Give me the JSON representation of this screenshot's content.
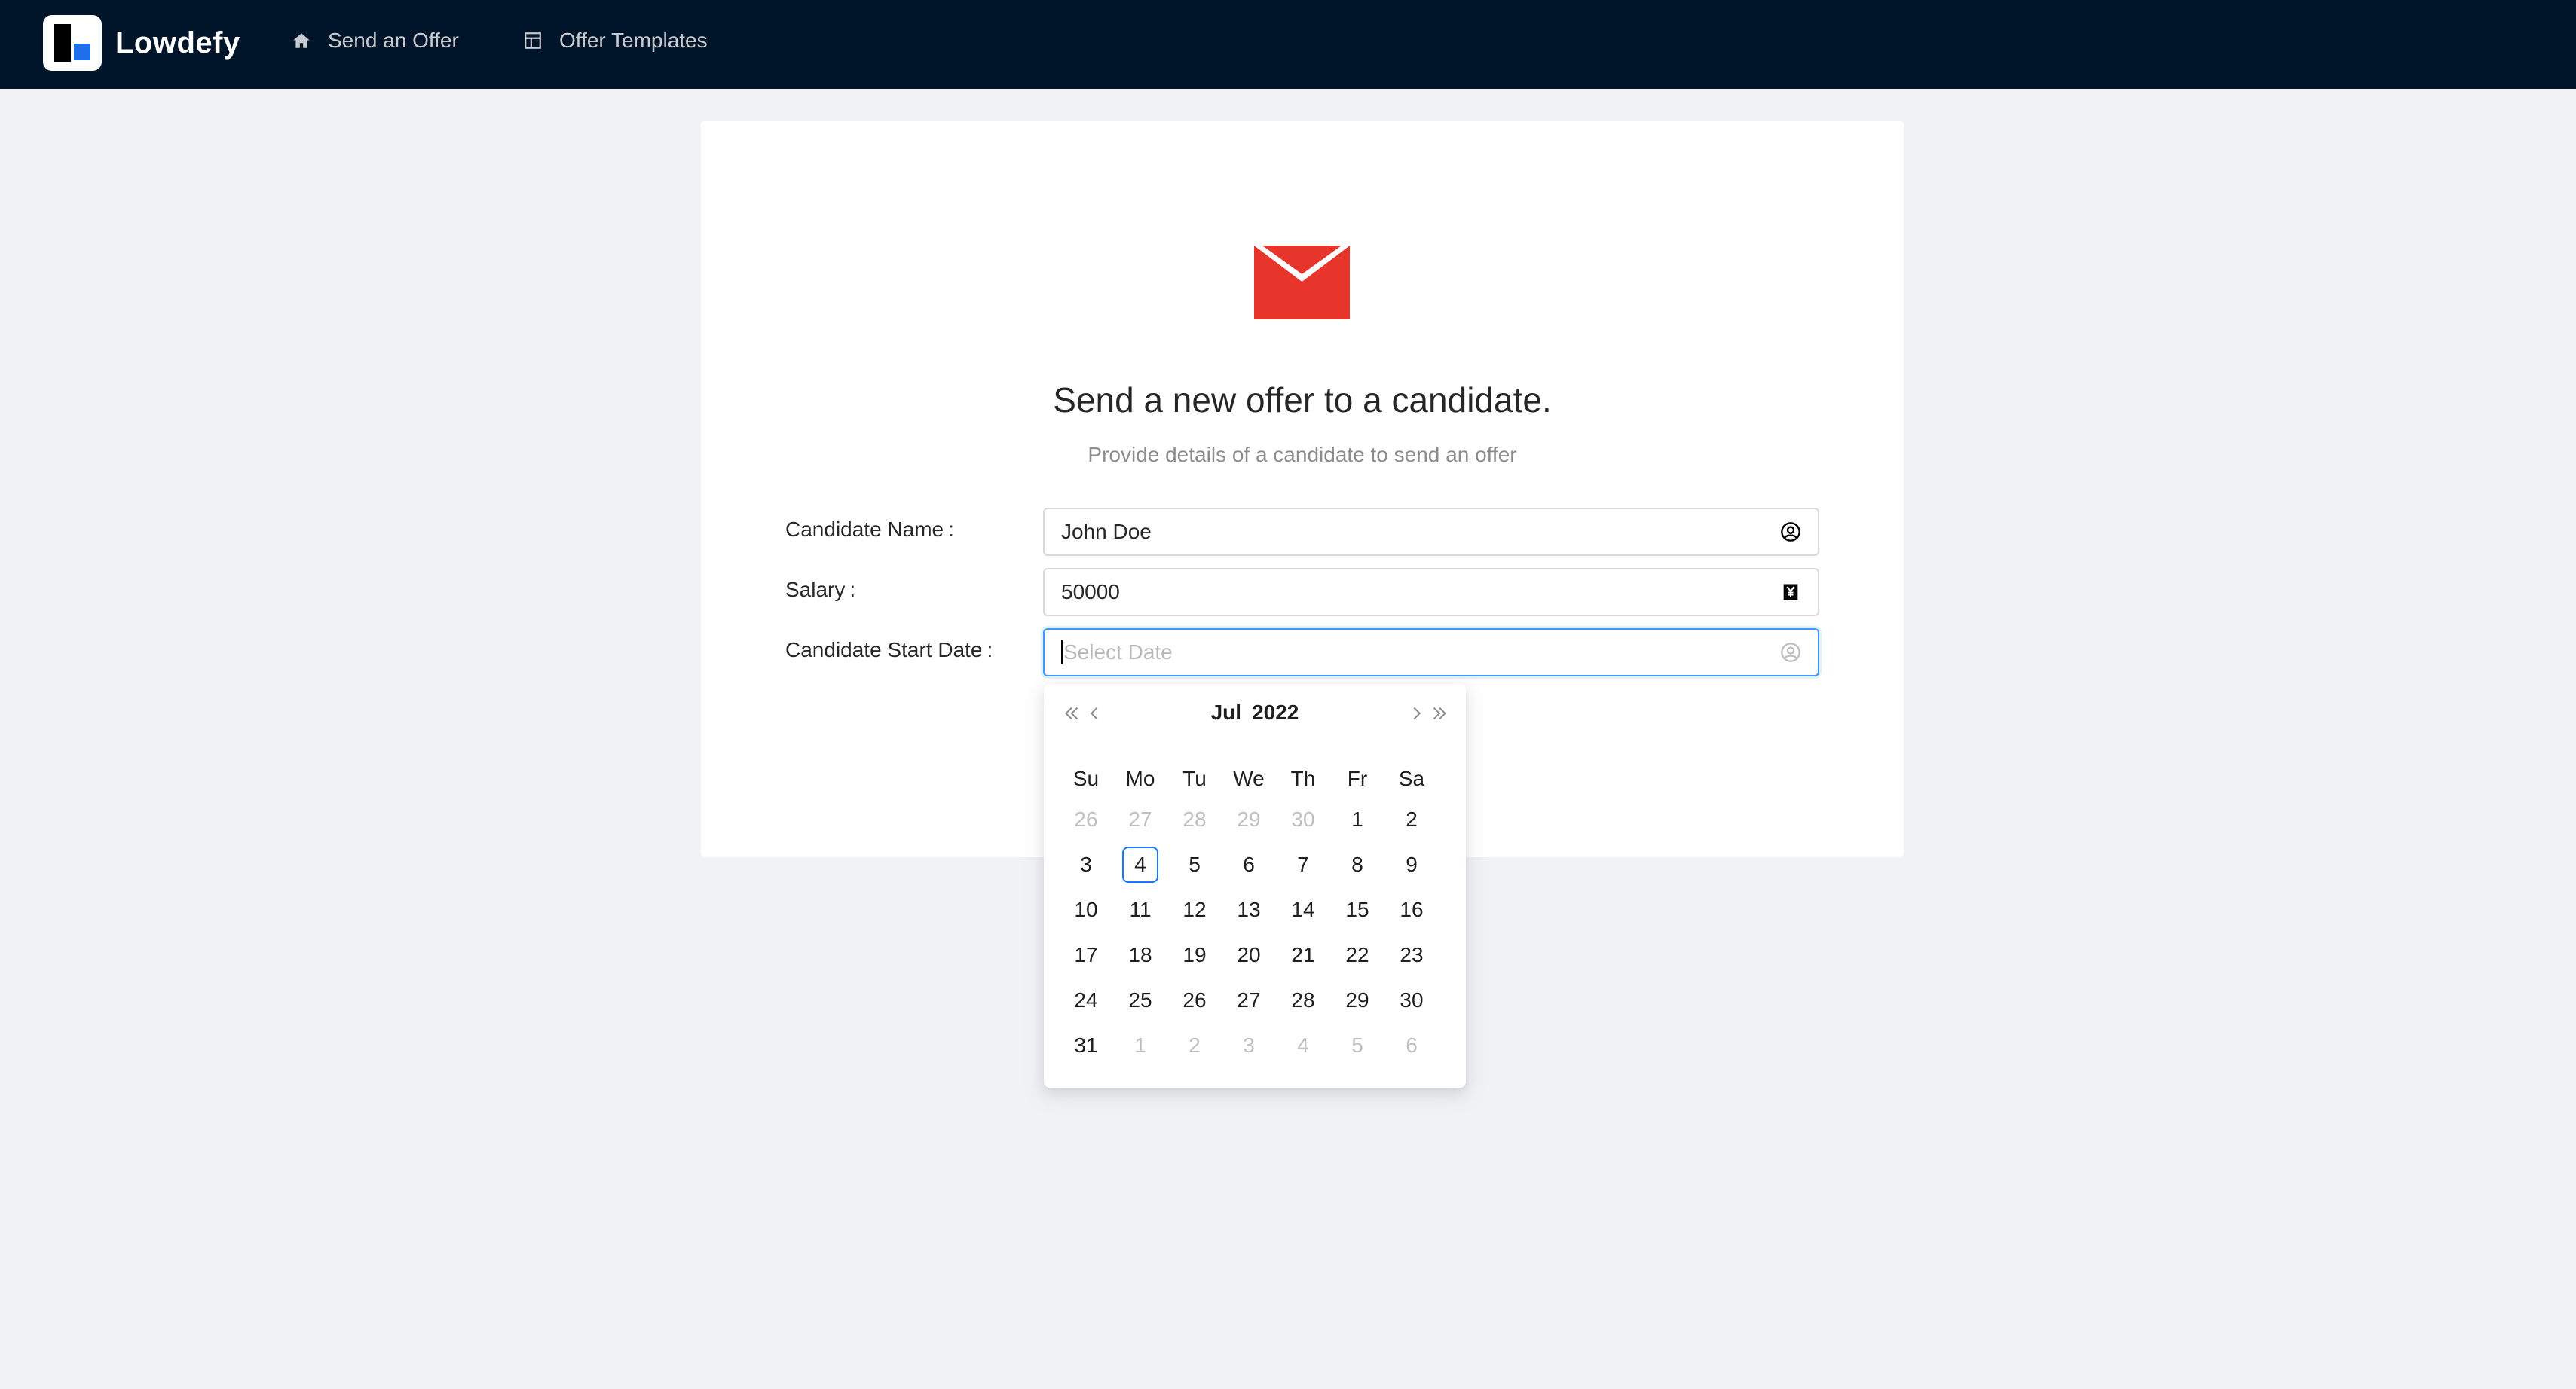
{
  "header": {
    "brand": "Lowdefy",
    "nav": [
      {
        "label": "Send an Offer",
        "icon": "home-icon"
      },
      {
        "label": "Offer Templates",
        "icon": "layout-icon"
      }
    ]
  },
  "main": {
    "icon": "envelope-icon",
    "title": "Send a new offer to a candidate.",
    "subtitle": "Provide details of a candidate to send an offer",
    "form": {
      "candidate_name": {
        "label": "Candidate Name",
        "value": "John Doe",
        "icon": "user-circle-icon"
      },
      "salary": {
        "label": "Salary",
        "value": "50000",
        "icon": "yen-icon"
      },
      "start_date": {
        "label": "Candidate Start Date",
        "placeholder": "Select Date",
        "icon": "user-circle-icon"
      }
    }
  },
  "datepicker": {
    "month": "Jul",
    "year": "2022",
    "weekdays": [
      "Su",
      "Mo",
      "Tu",
      "We",
      "Th",
      "Fr",
      "Sa"
    ],
    "weeks": [
      [
        "26",
        "27",
        "28",
        "29",
        "30",
        "1",
        "2"
      ],
      [
        "3",
        "4",
        "5",
        "6",
        "7",
        "8",
        "9"
      ],
      [
        "10",
        "11",
        "12",
        "13",
        "14",
        "15",
        "16"
      ],
      [
        "17",
        "18",
        "19",
        "20",
        "21",
        "22",
        "23"
      ],
      [
        "24",
        "25",
        "26",
        "27",
        "28",
        "29",
        "30"
      ],
      [
        "31",
        "1",
        "2",
        "3",
        "4",
        "5",
        "6"
      ]
    ],
    "today": "4",
    "colors": {
      "accent": "#1677ff",
      "header_bg": "#001529",
      "envelope": "#e8352b"
    }
  }
}
